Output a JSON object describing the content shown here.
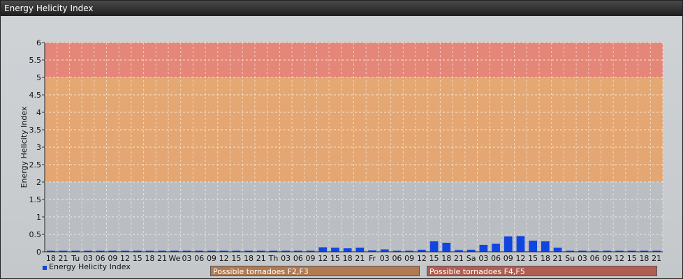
{
  "window": {
    "title": "Energy Helicity Index"
  },
  "chart_data": {
    "type": "bar",
    "ylabel": "Energy Helicity Index",
    "ylim": [
      0,
      6
    ],
    "yticks": [
      "0",
      "0.5",
      "1",
      "1.5",
      "2",
      "2.5",
      "3",
      "3.5",
      "4",
      "4.5",
      "5",
      "5.5",
      "6"
    ],
    "categories": [
      "18",
      "21",
      "Tu",
      "03",
      "06",
      "09",
      "12",
      "15",
      "18",
      "21",
      "We",
      "03",
      "06",
      "09",
      "12",
      "15",
      "18",
      "21",
      "Th",
      "03",
      "06",
      "09",
      "12",
      "15",
      "18",
      "21",
      "Fr",
      "03",
      "06",
      "09",
      "12",
      "15",
      "18",
      "21",
      "Sa",
      "03",
      "06",
      "09",
      "12",
      "15",
      "18",
      "21",
      "Su",
      "03",
      "06",
      "09",
      "12",
      "15",
      "18",
      "21"
    ],
    "series": [
      {
        "name": "Energy Helicity Index",
        "color": "#1045e0",
        "values": [
          0.01,
          0.01,
          0.01,
          0.01,
          0.01,
          0.01,
          0.01,
          0.01,
          0.01,
          0.01,
          0.02,
          0.02,
          0.01,
          0.01,
          0.01,
          0.02,
          0.01,
          0.02,
          0.02,
          0.03,
          0.01,
          0.02,
          0.13,
          0.12,
          0.1,
          0.12,
          0.04,
          0.07,
          0.02,
          0.02,
          0.06,
          0.3,
          0.26,
          0.05,
          0.06,
          0.2,
          0.23,
          0.44,
          0.45,
          0.32,
          0.3,
          0.12,
          0.01,
          0.01,
          0.01,
          0.01,
          0.01,
          0.01,
          0.01,
          0.01
        ]
      }
    ],
    "grid": true,
    "bands": [
      {
        "from": 0,
        "to": 2,
        "color": "#b9bcc0"
      },
      {
        "from": 2,
        "to": 5,
        "color": "#e6a46a",
        "label": "Possible tornadoes F2,F3"
      },
      {
        "from": 5,
        "to": 6,
        "color": "#e68070",
        "label": "Possible tornadoes F4,F5"
      }
    ],
    "legend": "bottom-left"
  }
}
